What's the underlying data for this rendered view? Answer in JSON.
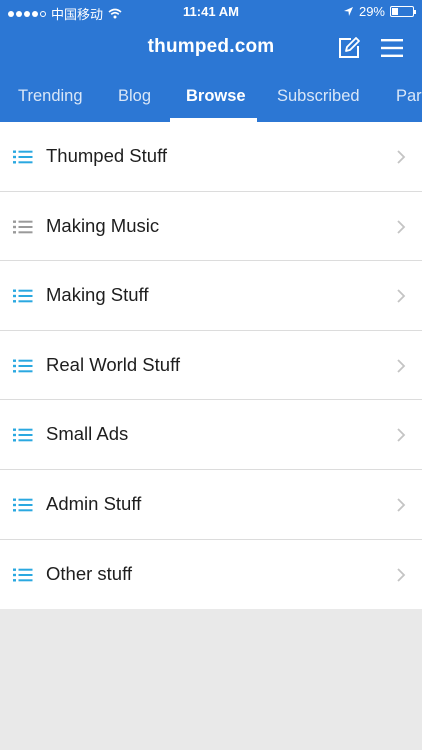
{
  "status_bar": {
    "carrier": "中国移动",
    "time": "11:41 AM",
    "battery": "29%",
    "battery_level": 0.29
  },
  "header": {
    "title": "thumped.com",
    "edit_icon": "compose-icon",
    "menu_icon": "hamburger-menu-icon"
  },
  "tabs": [
    {
      "label": "Trending",
      "active": false
    },
    {
      "label": "Blog",
      "active": false
    },
    {
      "label": "Browse",
      "active": true
    },
    {
      "label": "Subscribed",
      "active": false
    },
    {
      "label": "Par",
      "active": false
    }
  ],
  "categories": [
    {
      "label": "Thumped Stuff",
      "icon": "list-icon",
      "icon_color": "#2aa8e0"
    },
    {
      "label": "Making Music",
      "icon": "list-icon",
      "icon_color": "#9a9a9a"
    },
    {
      "label": "Making Stuff",
      "icon": "list-icon",
      "icon_color": "#2aa8e0"
    },
    {
      "label": "Real World Stuff",
      "icon": "list-icon",
      "icon_color": "#2aa8e0"
    },
    {
      "label": "Small Ads",
      "icon": "list-icon",
      "icon_color": "#2aa8e0"
    },
    {
      "label": "Admin Stuff",
      "icon": "list-icon",
      "icon_color": "#2aa8e0"
    },
    {
      "label": "Other stuff",
      "icon": "list-icon",
      "icon_color": "#2aa8e0"
    }
  ],
  "colors": {
    "header_bg": "#2c77d4",
    "page_bg": "#e9e9e9",
    "chevron": "#c4c4c4"
  }
}
